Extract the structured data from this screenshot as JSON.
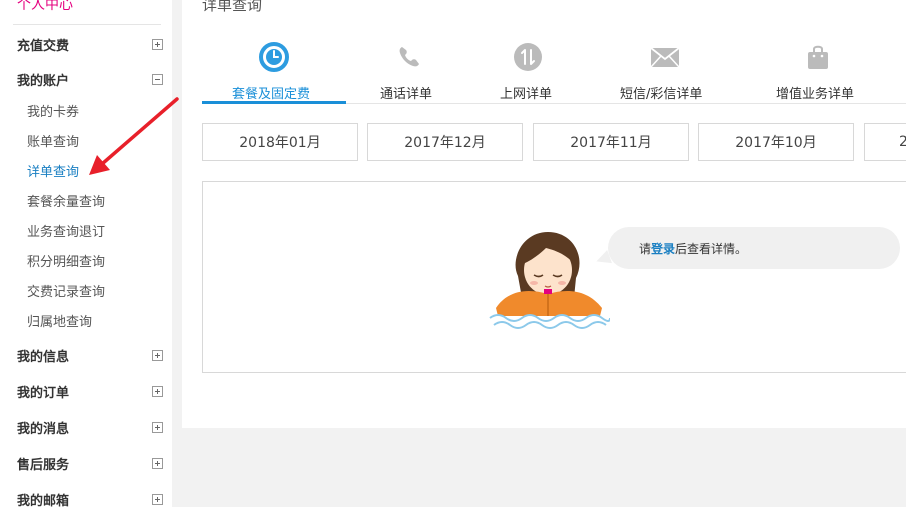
{
  "sidebar": {
    "title": "个人中心",
    "groups": [
      {
        "label": "充值交费",
        "expanded": false
      },
      {
        "label": "我的账户",
        "expanded": true
      },
      {
        "label": "我的信息",
        "expanded": false
      },
      {
        "label": "我的订单",
        "expanded": false
      },
      {
        "label": "我的消息",
        "expanded": false
      },
      {
        "label": "售后服务",
        "expanded": false
      },
      {
        "label": "我的邮箱",
        "expanded": false
      }
    ],
    "account_items": [
      {
        "label": "我的卡券"
      },
      {
        "label": "账单查询"
      },
      {
        "label": "详单查询",
        "active": true
      },
      {
        "label": "套餐余量查询"
      },
      {
        "label": "业务查询退订"
      },
      {
        "label": "积分明细查询"
      },
      {
        "label": "交费记录查询"
      },
      {
        "label": "归属地查询"
      }
    ]
  },
  "main": {
    "title": "详单查询",
    "tabs": [
      {
        "label": "套餐及固定费",
        "icon": "clock-icon",
        "active": true
      },
      {
        "label": "通话详单",
        "icon": "phone-icon"
      },
      {
        "label": "上网详单",
        "icon": "data-transfer-icon"
      },
      {
        "label": "短信/彩信详单",
        "icon": "envelope-icon"
      },
      {
        "label": "增值业务详单",
        "icon": "shopping-bag-icon"
      }
    ],
    "months": [
      "2018年01月",
      "2017年12月",
      "2017年11月",
      "2017年10月",
      "2"
    ],
    "message": {
      "prefix": "请",
      "link": "登录",
      "suffix": "后查看详情。"
    }
  },
  "colors": {
    "accent": "#1a8fd8",
    "sidebar_title": "#e4007f",
    "active_link": "#1a7fc2",
    "arrow": "#e8202a"
  }
}
